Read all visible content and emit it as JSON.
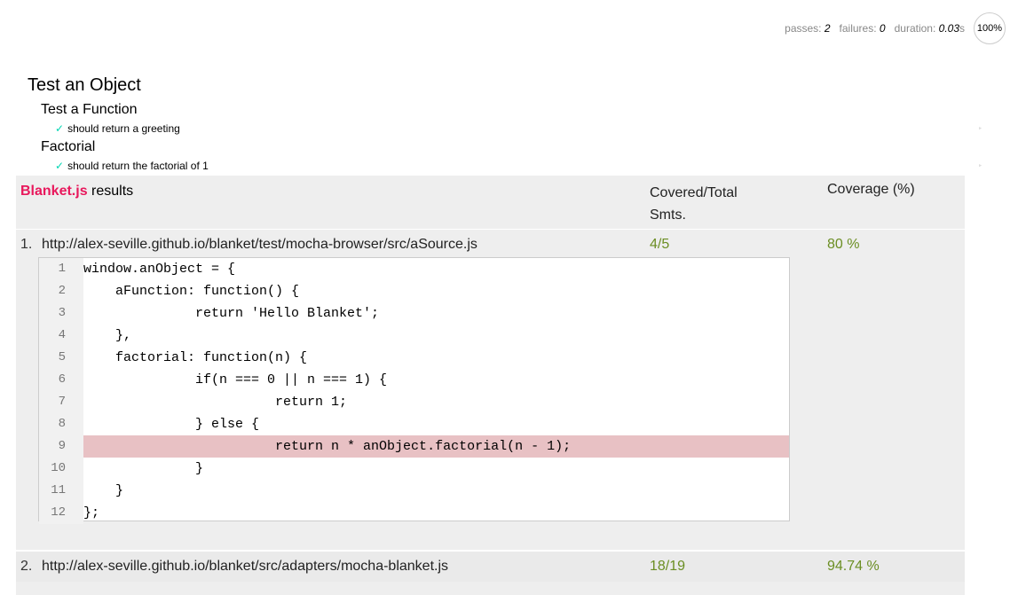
{
  "stats": {
    "passes_label": "passes:",
    "passes_value": "2",
    "failures_label": "failures:",
    "failures_value": "0",
    "duration_label": "duration:",
    "duration_value": "0.03",
    "duration_unit": "s",
    "progress": "100%"
  },
  "report": {
    "suite": "Test an Object",
    "subsuites": [
      {
        "title": "Test a Function",
        "test": "should return a greeting",
        "check": "✓",
        "replay": "‣"
      },
      {
        "title": "Factorial",
        "test": "should return the factorial of 1",
        "check": "✓",
        "replay": "‣"
      }
    ]
  },
  "blanket": {
    "brand": "Blanket.js",
    "title_suffix": " results",
    "col_covered_line1": "Covered/Total",
    "col_covered_line2": "Smts.",
    "col_coverage": "Coverage (%)",
    "files": [
      {
        "num": "1.",
        "path": "http://alex-seville.github.io/blanket/test/mocha-browser/src/aSource.js",
        "covered": "4/5",
        "pct": "80 %",
        "lines": [
          {
            "n": "1",
            "code": "window.anObject = {",
            "miss": false
          },
          {
            "n": "2",
            "code": "    aFunction: function() {",
            "miss": false
          },
          {
            "n": "3",
            "code": "              return 'Hello Blanket';",
            "miss": false
          },
          {
            "n": "4",
            "code": "    },",
            "miss": false
          },
          {
            "n": "5",
            "code": "    factorial: function(n) {",
            "miss": false
          },
          {
            "n": "6",
            "code": "              if(n === 0 || n === 1) {",
            "miss": false
          },
          {
            "n": "7",
            "code": "                        return 1;",
            "miss": false
          },
          {
            "n": "8",
            "code": "              } else {",
            "miss": false
          },
          {
            "n": "9",
            "code": "                        return n * anObject.factorial(n - 1);",
            "miss": true
          },
          {
            "n": "10",
            "code": "              }",
            "miss": false
          },
          {
            "n": "11",
            "code": "    }",
            "miss": false
          },
          {
            "n": "12",
            "code": "};",
            "miss": false
          }
        ]
      },
      {
        "num": "2.",
        "path": "http://alex-seville.github.io/blanket/src/adapters/mocha-blanket.js",
        "covered": "18/19",
        "pct": "94.74 %"
      }
    ]
  },
  "colors": {
    "brand": "#e8185c",
    "coverage_text": "#6b8e23",
    "miss_line": "#e8c1c4",
    "pass_check": "#00d6b2"
  }
}
